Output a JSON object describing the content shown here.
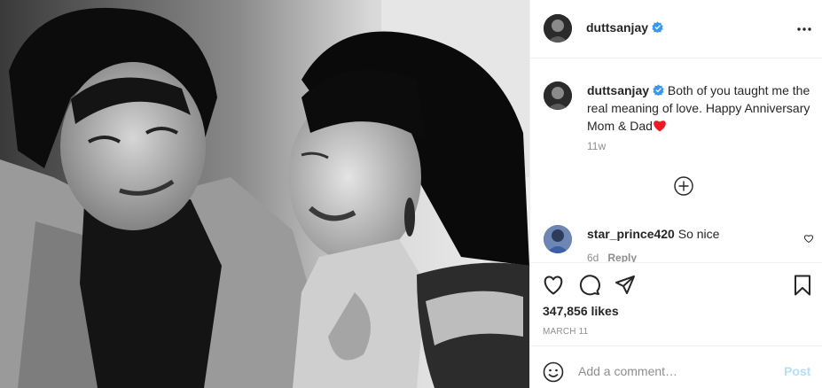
{
  "post": {
    "author": "duttsanjay",
    "verified": true
  },
  "header": {
    "username": "duttsanjay",
    "more_icon": "more-horizontal-icon"
  },
  "caption": {
    "username": "duttsanjay",
    "text": "Both of you taught me the real meaning of love. Happy Anniversary Mom & Dad",
    "emoji": "red-heart",
    "time_ago": "11w"
  },
  "load_more_icon": "plus-circle-icon",
  "comments": [
    {
      "username": "star_prince420",
      "text": "So nice",
      "time_ago": "6d",
      "reply_label": "Reply"
    }
  ],
  "actions": {
    "likes": "347,856 likes",
    "date": "MARCH 11",
    "icons": [
      "heart-icon",
      "comment-icon",
      "share-icon",
      "bookmark-icon"
    ]
  },
  "add_comment": {
    "placeholder": "Add a comment…",
    "post_label": "Post"
  },
  "colors": {
    "verified_blue": "#3897f0",
    "post_disabled": "#b2dffc",
    "muted": "#8e8e8e",
    "heart_red": "#ed1c24"
  }
}
